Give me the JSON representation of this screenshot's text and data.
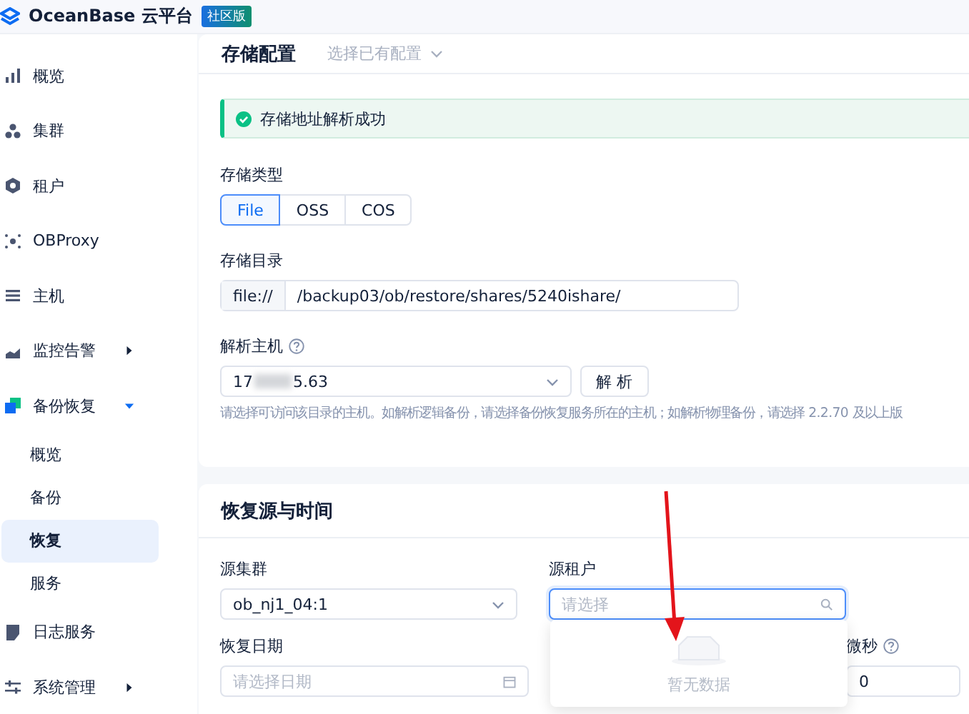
{
  "header": {
    "product": "OceanBase 云平台",
    "edition_badge": "社区版"
  },
  "sidebar": {
    "items": [
      {
        "label": "概览",
        "selected": false
      },
      {
        "label": "集群",
        "selected": false
      },
      {
        "label": "租户",
        "selected": false
      },
      {
        "label": "OBProxy",
        "selected": false
      },
      {
        "label": "主机",
        "selected": false
      },
      {
        "label": "监控告警",
        "selected": false,
        "expanded": false
      },
      {
        "label": "备份恢复",
        "selected": false,
        "expanded": true,
        "children": [
          {
            "label": "概览",
            "selected": false
          },
          {
            "label": "备份",
            "selected": false
          },
          {
            "label": "恢复",
            "selected": true
          },
          {
            "label": "服务",
            "selected": false
          }
        ]
      },
      {
        "label": "日志服务",
        "selected": false
      },
      {
        "label": "系统管理",
        "selected": false,
        "expanded": false
      }
    ]
  },
  "storage_card": {
    "title": "存储配置",
    "config_select": "选择已有配置",
    "alert": "存储地址解析成功",
    "type_label": "存储类型",
    "types": [
      {
        "label": "File",
        "selected": true
      },
      {
        "label": "OSS",
        "selected": false
      },
      {
        "label": "COS",
        "selected": false
      }
    ],
    "dir_label": "存储目录",
    "dir_prefix": "file://",
    "dir_value": "/backup03/ob/restore/shares/5240ishare/",
    "host_label": "解析主机",
    "host_value_start": "17",
    "host_value_end": "5.63",
    "parse_button": "解 析",
    "host_hint": "请选择可访问该目录的主机。如解析逻辑备份，请选择备份恢复服务所在的主机；如解析物理备份，请选择 2.2.70 及以上版"
  },
  "source_card": {
    "title": "恢复源与时间",
    "cluster_label": "源集群",
    "cluster_value": "ob_nj1_04:1",
    "tenant_label": "源租户",
    "tenant_placeholder": "请选择",
    "tenant_focused": true,
    "date_label": "恢复日期",
    "date_placeholder": "请选择日期",
    "micro_label": "微秒",
    "micro_value": "0"
  },
  "dropdown": {
    "empty_text": "暂无数据"
  }
}
